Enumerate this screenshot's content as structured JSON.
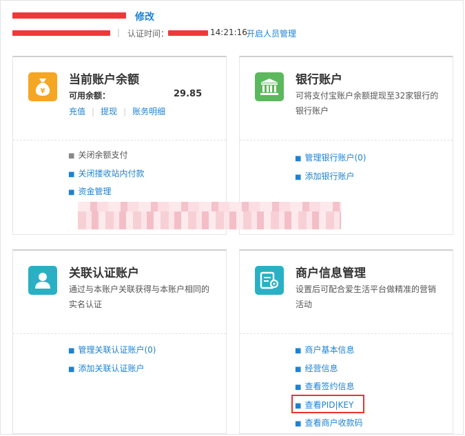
{
  "header": {
    "edit_label": "修改",
    "auth_label": "认证时间：",
    "auth_time": "14:21:16",
    "manage_link": "开启人员管理",
    "separator": "|"
  },
  "cards": {
    "balance": {
      "title": "当前账户余额",
      "available_label": "可用余额：",
      "available_value": "29.85",
      "actions": [
        "充值",
        "提现",
        "账务明细"
      ],
      "links": [
        "关闭余额支付",
        "关闭搂收站内付款",
        "资金管理"
      ],
      "icon": "money-bag-icon",
      "icon_color": "#f5a623"
    },
    "bank": {
      "title": "银行账户",
      "description": "可将支付宝账户余额提现至32家银行的银行账户",
      "links": [
        "管理银行账户(0)",
        "添加银行账户"
      ],
      "icon": "bank-icon",
      "icon_color": "#5cb85c"
    },
    "linked": {
      "title": "关联认证账户",
      "description": "通过与本账户关联获得与本账户相同的实名认证",
      "links": [
        "管理关联认证账户(0)",
        "添加关联认证账户"
      ],
      "icon": "user-icon",
      "icon_color": "#2ab0c5"
    },
    "merchant": {
      "title": "商户信息管理",
      "description": "设置后可配合爱生活平台做精准的营销活动",
      "links": [
        "商户基本信息",
        "经营信息",
        "查看签约信息",
        "查看PID|KEY",
        "查看商户收款码"
      ],
      "icon": "settings-doc-icon",
      "icon_color": "#2ab0c5"
    }
  },
  "colors": {
    "link": "#1d82d3",
    "highlight": "#e8332f",
    "redaction": "#f0383a"
  }
}
